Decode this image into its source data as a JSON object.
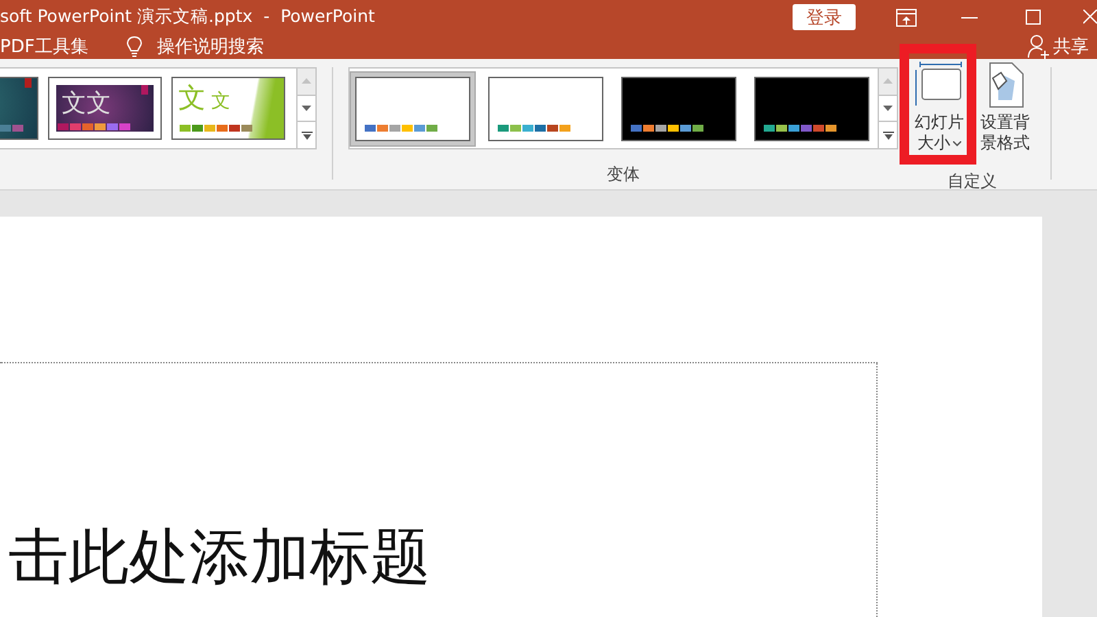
{
  "window": {
    "title": "soft PowerPoint 演示文稿.pptx  -  PowerPoint",
    "sign_in": "登录"
  },
  "tell_bar": {
    "addin": "PDF工具集",
    "search": "操作说明搜索",
    "share": "共享"
  },
  "themes": [
    {
      "kind": "teal",
      "swatches": [
        {
          "color": "#4b7f96"
        },
        {
          "color": "#a0528f"
        }
      ]
    },
    {
      "kind": "purple",
      "title": "文文",
      "swatches": [
        {
          "color": "#b0185f"
        },
        {
          "color": "#e23d6c"
        },
        {
          "color": "#e4632c"
        },
        {
          "color": "#ef9a3c"
        },
        {
          "color": "#9a6cef"
        },
        {
          "color": "#d742c8"
        }
      ]
    },
    {
      "kind": "green",
      "title": "文",
      "subtitle": "文",
      "swatches": [
        {
          "color": "#8cbf26"
        },
        {
          "color": "#4c9a1b"
        },
        {
          "color": "#e8b71a"
        },
        {
          "color": "#e86c1a"
        },
        {
          "color": "#c0351f"
        },
        {
          "color": "#9b8a5a"
        }
      ]
    }
  ],
  "variants": {
    "label": "变体",
    "items": [
      {
        "selected": true,
        "kind": "light",
        "swatches": [
          {
            "color": "#4472c4"
          },
          {
            "color": "#ed7d31"
          },
          {
            "color": "#a5a5a5"
          },
          {
            "color": "#ffc000"
          },
          {
            "color": "#5b9bd5"
          },
          {
            "color": "#70ad47"
          }
        ]
      },
      {
        "selected": false,
        "kind": "light",
        "swatches": [
          {
            "color": "#1a9a7c"
          },
          {
            "color": "#8cc04b"
          },
          {
            "color": "#3ab0d0"
          },
          {
            "color": "#1d6fa5"
          },
          {
            "color": "#b8451e"
          },
          {
            "color": "#f3a11c"
          }
        ]
      },
      {
        "selected": false,
        "kind": "dark",
        "swatches": [
          {
            "color": "#4472c4"
          },
          {
            "color": "#ed7d31"
          },
          {
            "color": "#a5a5a5"
          },
          {
            "color": "#ffc000"
          },
          {
            "color": "#5b9bd5"
          },
          {
            "color": "#70ad47"
          }
        ]
      },
      {
        "selected": false,
        "kind": "dark",
        "swatches": [
          {
            "color": "#23a991"
          },
          {
            "color": "#97c14b"
          },
          {
            "color": "#3aa0d6"
          },
          {
            "color": "#8058c8"
          },
          {
            "color": "#d04a2c"
          },
          {
            "color": "#e6952c"
          }
        ]
      }
    ]
  },
  "customize": {
    "label": "自定义",
    "buttons": [
      {
        "kind": "slide-size",
        "lines": [
          "幻灯片",
          "大小"
        ],
        "dropdown": true,
        "highlighted": true
      },
      {
        "kind": "background",
        "lines": [
          "设置背",
          "景格式"
        ],
        "dropdown": false,
        "highlighted": false
      }
    ]
  },
  "slide": {
    "title_placeholder": "击此处添加标题"
  }
}
